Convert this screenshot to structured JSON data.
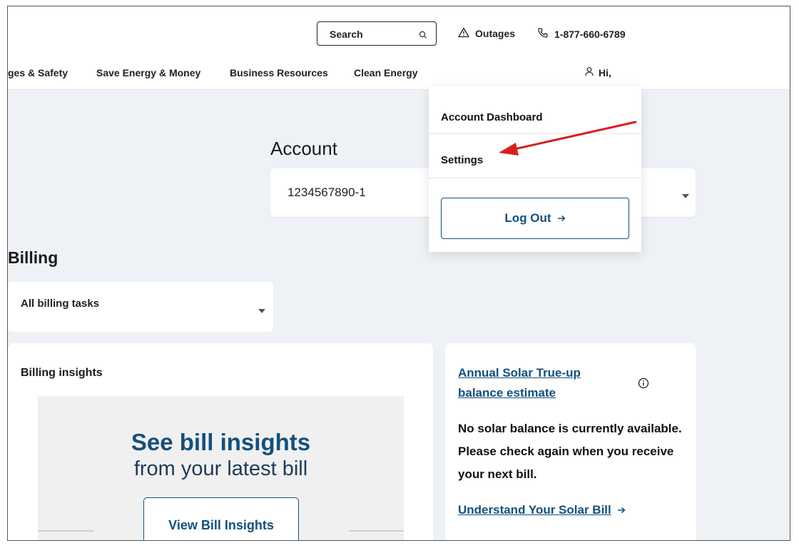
{
  "header": {
    "search_label": "Search",
    "outages_label": "Outages",
    "phone": "1-877-660-6789",
    "greeting": "Hi,"
  },
  "nav": {
    "items": [
      {
        "label": "ges & Safety"
      },
      {
        "label": "Save Energy & Money"
      },
      {
        "label": "Business Resources"
      },
      {
        "label": "Clean Energy"
      }
    ]
  },
  "account_menu": {
    "items": [
      {
        "label": "Account Dashboard"
      },
      {
        "label": "Settings"
      }
    ],
    "logout_label": "Log Out"
  },
  "account": {
    "title": "Account",
    "selected": "1234567890-1"
  },
  "billing": {
    "title": "Billing",
    "task_select": "All billing tasks"
  },
  "insights": {
    "title": "Billing insights",
    "headline": "See bill insights",
    "subheadline": "from your latest bill",
    "button_label": "View Bill Insights"
  },
  "solar": {
    "title": "Annual Solar True-up balance estimate",
    "message": "No solar balance is currently available. Please check again when you receive your next bill.",
    "link_label": "Understand Your Solar Bill"
  },
  "icons": {
    "search": "search-icon",
    "outage": "warning-triangle-icon",
    "phone": "phone-icon",
    "user": "user-icon",
    "info": "info-icon",
    "arrow": "arrow-right-icon",
    "caret": "caret-down-icon"
  },
  "colors": {
    "brand_blue": "#13507e",
    "page_bg": "#eef2f6",
    "annotation_red": "#d6201f"
  }
}
